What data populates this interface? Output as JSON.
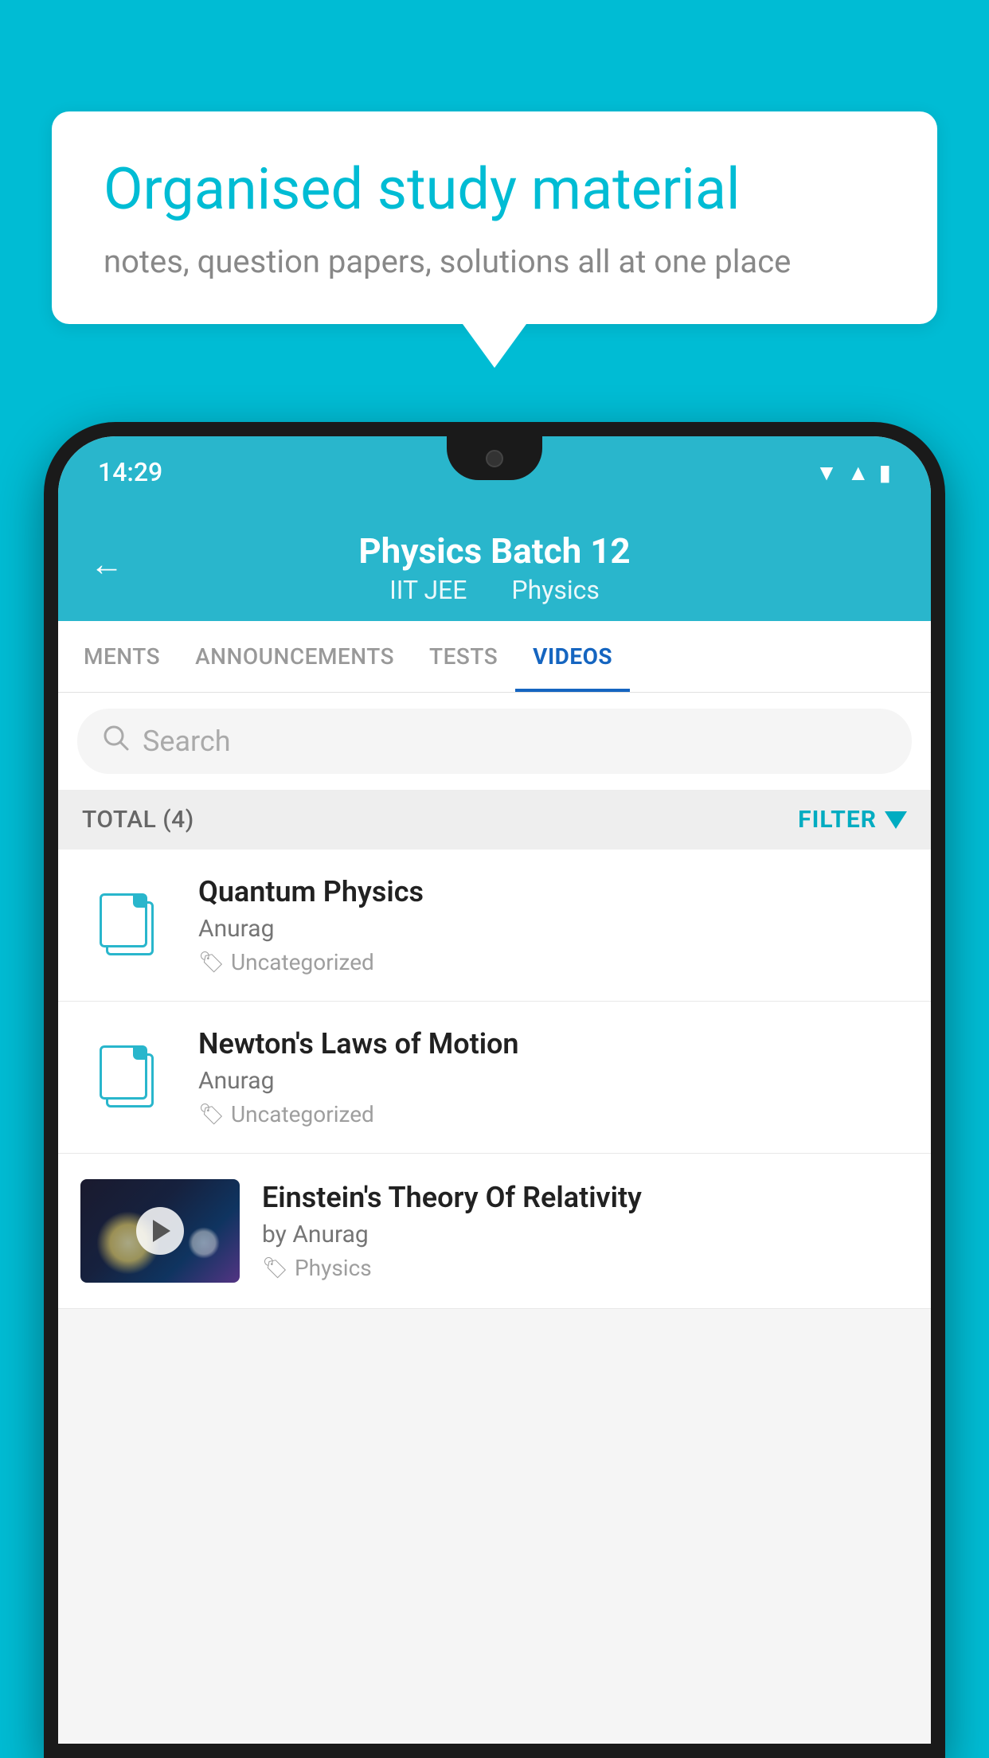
{
  "background_color": "#00BCD4",
  "speech_bubble": {
    "title": "Organised study material",
    "subtitle": "notes, question papers, solutions all at one place"
  },
  "phone": {
    "status_bar": {
      "time": "14:29"
    },
    "header": {
      "title": "Physics Batch 12",
      "subtitle_part1": "IIT JEE",
      "subtitle_part2": "Physics",
      "back_label": "←"
    },
    "tabs": [
      {
        "label": "MENTS",
        "active": false
      },
      {
        "label": "ANNOUNCEMENTS",
        "active": false
      },
      {
        "label": "TESTS",
        "active": false
      },
      {
        "label": "VIDEOS",
        "active": true
      }
    ],
    "search": {
      "placeholder": "Search"
    },
    "filter": {
      "total_label": "TOTAL (4)",
      "filter_label": "FILTER"
    },
    "videos": [
      {
        "id": "quantum",
        "title": "Quantum Physics",
        "author": "Anurag",
        "tag": "Uncategorized",
        "has_thumb": false
      },
      {
        "id": "newton",
        "title": "Newton's Laws of Motion",
        "author": "Anurag",
        "tag": "Uncategorized",
        "has_thumb": false
      },
      {
        "id": "einstein",
        "title": "Einstein's Theory Of Relativity",
        "author": "by Anurag",
        "tag": "Physics",
        "has_thumb": true
      }
    ]
  }
}
